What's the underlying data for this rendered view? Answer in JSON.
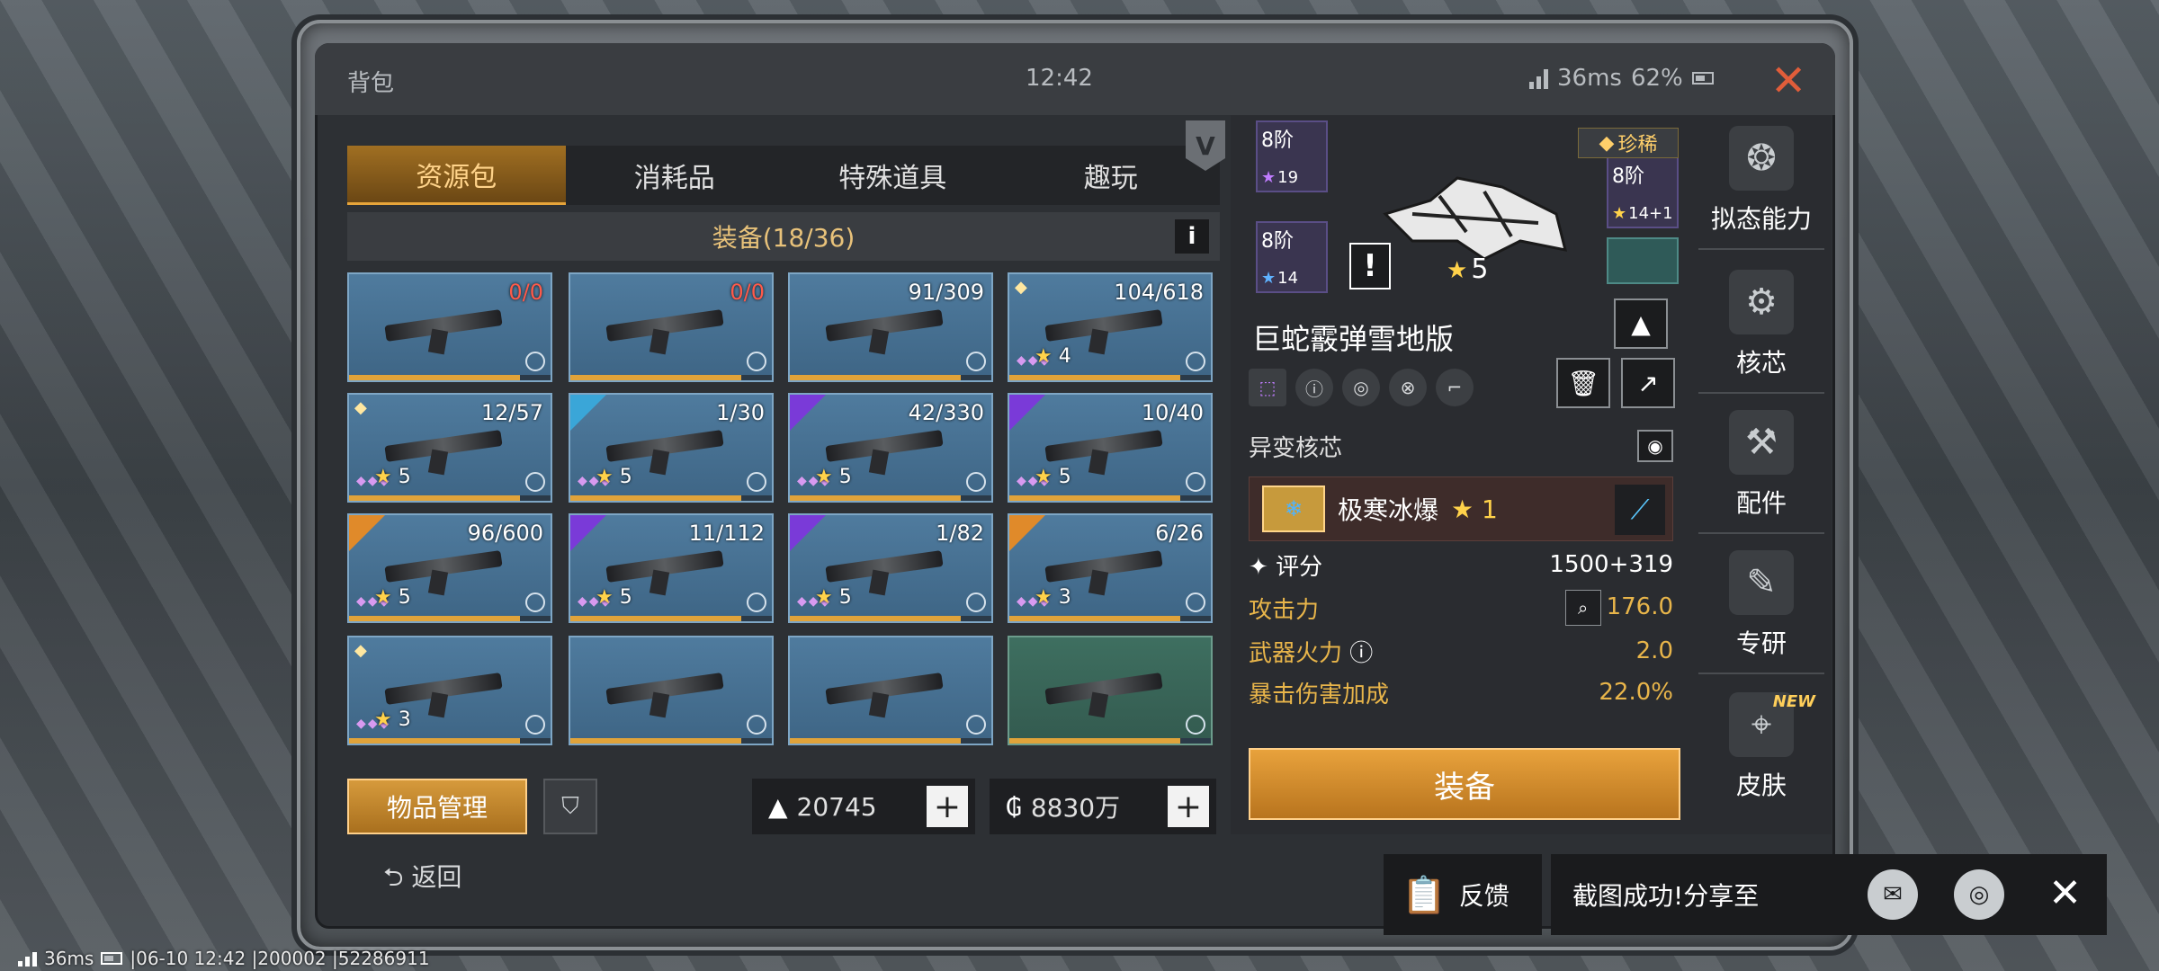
{
  "window": {
    "title": "背包",
    "time": "12:42",
    "ping": "36ms",
    "battery": "62%"
  },
  "tabs": [
    {
      "label": "资源包",
      "active": true
    },
    {
      "label": "消耗品",
      "active": false
    },
    {
      "label": "特殊道具",
      "active": false
    },
    {
      "label": "趣玩",
      "active": false
    }
  ],
  "equip_header": "装备(18/36)",
  "items": [
    {
      "count": "0/0",
      "red": true,
      "type": "fishing-rod"
    },
    {
      "count": "0/0",
      "red": true,
      "type": "fishing-rod"
    },
    {
      "count": "91/309",
      "type": "rifle"
    },
    {
      "count": "104/618",
      "stars": "4",
      "type": "rifle"
    },
    {
      "count": "12/57",
      "stars": "5",
      "type": "rifle"
    },
    {
      "count": "1/30",
      "stars": "5",
      "type": "snow-rifle"
    },
    {
      "count": "42/330",
      "stars": "5",
      "type": "rifle"
    },
    {
      "count": "10/40",
      "stars": "5",
      "type": "sniper"
    },
    {
      "count": "96/600",
      "stars": "5",
      "type": "rifle"
    },
    {
      "count": "11/112",
      "stars": "5",
      "type": "pistols"
    },
    {
      "count": "1/82",
      "stars": "5",
      "type": "crossbow"
    },
    {
      "count": "6/26",
      "stars": "3",
      "type": "yellow-rifle"
    },
    {
      "count": "",
      "stars": "3",
      "type": "mace"
    },
    {
      "count": "",
      "type": "yellow-machine"
    },
    {
      "count": "",
      "type": "axe"
    },
    {
      "count": "",
      "type": "ladle"
    }
  ],
  "bottom": {
    "manage_label": "物品管理",
    "currency1": "20745",
    "currency2": "8830万",
    "back_label": "返回"
  },
  "detail": {
    "tiers": [
      {
        "tier": "8阶",
        "stars": "19"
      },
      {
        "tier": "8阶",
        "stars": "14"
      },
      {
        "tier": "8阶",
        "stars": "14+1"
      }
    ],
    "rarity": "珍稀",
    "star_level": "5",
    "weapon_name": "巨蛇霰弹雪地版",
    "mutation_title": "异变核芯",
    "core_name": "极寒冰爆",
    "core_level": "1",
    "score_label": "评分",
    "score_value": "1500+319",
    "stats": [
      {
        "label": "攻击力",
        "value": "176.0"
      },
      {
        "label": "武器火力",
        "value": "2.0"
      },
      {
        "label": "暴击伤害加成",
        "value": "22.0%"
      }
    ],
    "equip_label": "装备"
  },
  "sidebar": [
    {
      "label": "拟态能力",
      "icon": "mimic-icon"
    },
    {
      "label": "核芯",
      "icon": "core-icon"
    },
    {
      "label": "配件",
      "icon": "parts-icon"
    },
    {
      "label": "专研",
      "icon": "research-icon"
    },
    {
      "label": "皮肤",
      "icon": "skin-icon",
      "new": "NEW"
    }
  ],
  "toast": {
    "feedback_label": "反馈",
    "share_text": "截图成功!分享至"
  },
  "statusline": {
    "ping": "36ms",
    "info": "|06-10 12:42 |200002 |52286911"
  }
}
